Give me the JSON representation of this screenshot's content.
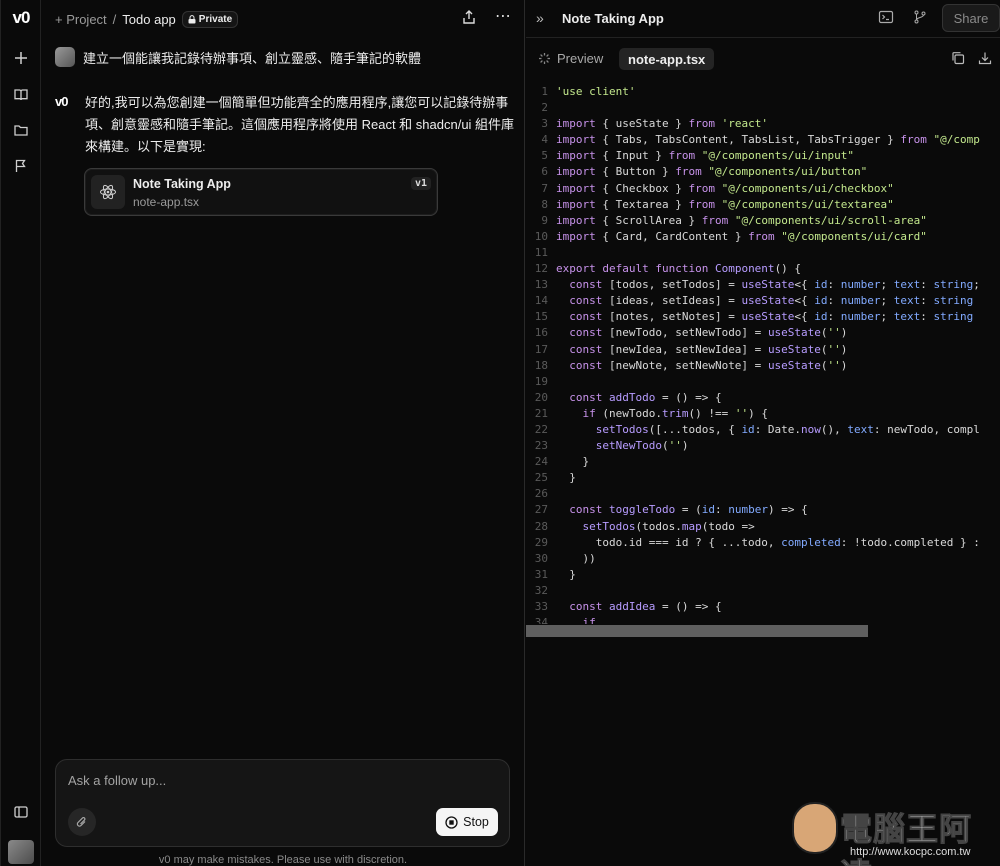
{
  "rail": {
    "logo": "v0",
    "items": [
      "new-chat",
      "library",
      "projects",
      "feedback"
    ]
  },
  "header": {
    "new_label": "+ Project",
    "separator": "/",
    "project_name": "Todo app",
    "privacy": "Private"
  },
  "user_message": {
    "text": "建立一個能讓我記錄待辦事項、創立靈感、隨手筆記的軟體"
  },
  "assistant_message": {
    "logo": "v0",
    "text": "好的,我可以為您創建一個簡單但功能齊全的應用程序,讓您可以記錄待辦事項、創意靈感和隨手筆記。這個應用程序將使用 React 和 shadcn/ui 組件庫來構建。以下是實現:"
  },
  "artifact": {
    "title": "Note Taking App",
    "file": "note-app.tsx",
    "version": "v1"
  },
  "composer": {
    "placeholder": "Ask a follow up...",
    "stop_label": "Stop",
    "disclaimer": "v0 may make mistakes. Please use with discretion."
  },
  "code_panel": {
    "title": "Note Taking App",
    "share_label": "Share",
    "preview_tab": "Preview",
    "file_tab": "note-app.tsx"
  },
  "code_lines": [
    [
      [
        "str",
        "'use client'"
      ]
    ],
    [],
    [
      [
        "kw",
        "import"
      ],
      [
        "pl",
        " { useState } "
      ],
      [
        "kw",
        "from"
      ],
      [
        "str",
        " 'react'"
      ]
    ],
    [
      [
        "kw",
        "import"
      ],
      [
        "pl",
        " { Tabs, TabsContent, TabsList, TabsTrigger } "
      ],
      [
        "kw",
        "from"
      ],
      [
        "str",
        " \"@/comp"
      ]
    ],
    [
      [
        "kw",
        "import"
      ],
      [
        "pl",
        " { Input } "
      ],
      [
        "kw",
        "from"
      ],
      [
        "str",
        " \"@/components/ui/input\""
      ]
    ],
    [
      [
        "kw",
        "import"
      ],
      [
        "pl",
        " { Button } "
      ],
      [
        "kw",
        "from"
      ],
      [
        "str",
        " \"@/components/ui/button\""
      ]
    ],
    [
      [
        "kw",
        "import"
      ],
      [
        "pl",
        " { Checkbox } "
      ],
      [
        "kw",
        "from"
      ],
      [
        "str",
        " \"@/components/ui/checkbox\""
      ]
    ],
    [
      [
        "kw",
        "import"
      ],
      [
        "pl",
        " { Textarea } "
      ],
      [
        "kw",
        "from"
      ],
      [
        "str",
        " \"@/components/ui/textarea\""
      ]
    ],
    [
      [
        "kw",
        "import"
      ],
      [
        "pl",
        " { ScrollArea } "
      ],
      [
        "kw",
        "from"
      ],
      [
        "str",
        " \"@/components/ui/scroll-area\""
      ]
    ],
    [
      [
        "kw",
        "import"
      ],
      [
        "pl",
        " { Card, CardContent } "
      ],
      [
        "kw",
        "from"
      ],
      [
        "str",
        " \"@/components/ui/card\""
      ]
    ],
    [],
    [
      [
        "kw",
        "export default function"
      ],
      [
        "fn",
        " Component"
      ],
      [
        "pl",
        "() {"
      ]
    ],
    [
      [
        "kw",
        "  const"
      ],
      [
        "pl",
        " [todos, setTodos] = "
      ],
      [
        "fn",
        "useState"
      ],
      [
        "pl",
        "<{ "
      ],
      [
        "ty",
        "id"
      ],
      [
        "pl",
        ": "
      ],
      [
        "ty",
        "number"
      ],
      [
        "pl",
        "; "
      ],
      [
        "ty",
        "text"
      ],
      [
        "pl",
        ": "
      ],
      [
        "ty",
        "string"
      ],
      [
        "pl",
        ";"
      ]
    ],
    [
      [
        "kw",
        "  const"
      ],
      [
        "pl",
        " [ideas, setIdeas] = "
      ],
      [
        "fn",
        "useState"
      ],
      [
        "pl",
        "<{ "
      ],
      [
        "ty",
        "id"
      ],
      [
        "pl",
        ": "
      ],
      [
        "ty",
        "number"
      ],
      [
        "pl",
        "; "
      ],
      [
        "ty",
        "text"
      ],
      [
        "pl",
        ": "
      ],
      [
        "ty",
        "string"
      ]
    ],
    [
      [
        "kw",
        "  const"
      ],
      [
        "pl",
        " [notes, setNotes] = "
      ],
      [
        "fn",
        "useState"
      ],
      [
        "pl",
        "<{ "
      ],
      [
        "ty",
        "id"
      ],
      [
        "pl",
        ": "
      ],
      [
        "ty",
        "number"
      ],
      [
        "pl",
        "; "
      ],
      [
        "ty",
        "text"
      ],
      [
        "pl",
        ": "
      ],
      [
        "ty",
        "string"
      ]
    ],
    [
      [
        "kw",
        "  const"
      ],
      [
        "pl",
        " [newTodo, setNewTodo] = "
      ],
      [
        "fn",
        "useState"
      ],
      [
        "pl",
        "("
      ],
      [
        "str",
        "''"
      ],
      [
        "pl",
        ")"
      ]
    ],
    [
      [
        "kw",
        "  const"
      ],
      [
        "pl",
        " [newIdea, setNewIdea] = "
      ],
      [
        "fn",
        "useState"
      ],
      [
        "pl",
        "("
      ],
      [
        "str",
        "''"
      ],
      [
        "pl",
        ")"
      ]
    ],
    [
      [
        "kw",
        "  const"
      ],
      [
        "pl",
        " [newNote, setNewNote] = "
      ],
      [
        "fn",
        "useState"
      ],
      [
        "pl",
        "("
      ],
      [
        "str",
        "''"
      ],
      [
        "pl",
        ")"
      ]
    ],
    [],
    [
      [
        "kw",
        "  const"
      ],
      [
        "fn",
        " addTodo"
      ],
      [
        "pl",
        " = () => {"
      ]
    ],
    [
      [
        "kw",
        "    if"
      ],
      [
        "pl",
        " (newTodo."
      ],
      [
        "fn",
        "trim"
      ],
      [
        "pl",
        "() !== "
      ],
      [
        "str",
        "''"
      ],
      [
        "pl",
        ") {"
      ]
    ],
    [
      [
        "fn",
        "      setTodos"
      ],
      [
        "pl",
        "([...todos, { "
      ],
      [
        "ty",
        "id"
      ],
      [
        "pl",
        ": Date."
      ],
      [
        "fn",
        "now"
      ],
      [
        "pl",
        "(), "
      ],
      [
        "ty",
        "text"
      ],
      [
        "pl",
        ": newTodo, compl"
      ]
    ],
    [
      [
        "fn",
        "      setNewTodo"
      ],
      [
        "pl",
        "("
      ],
      [
        "str",
        "''"
      ],
      [
        "pl",
        ")"
      ]
    ],
    [
      [
        "pl",
        "    }"
      ]
    ],
    [
      [
        "pl",
        "  }"
      ]
    ],
    [],
    [
      [
        "kw",
        "  const"
      ],
      [
        "fn",
        " toggleTodo"
      ],
      [
        "pl",
        " = ("
      ],
      [
        "ty",
        "id"
      ],
      [
        "pl",
        ": "
      ],
      [
        "ty",
        "number"
      ],
      [
        "pl",
        ") => {"
      ]
    ],
    [
      [
        "fn",
        "    setTodos"
      ],
      [
        "pl",
        "(todos."
      ],
      [
        "fn",
        "map"
      ],
      [
        "pl",
        "(todo =>"
      ]
    ],
    [
      [
        "pl",
        "      todo.id === id ? { ...todo, "
      ],
      [
        "ty",
        "completed"
      ],
      [
        "pl",
        ": !todo.completed } :"
      ]
    ],
    [
      [
        "pl",
        "    ))"
      ]
    ],
    [
      [
        "pl",
        "  }"
      ]
    ],
    [],
    [
      [
        "kw",
        "  const"
      ],
      [
        "fn",
        " addIdea"
      ],
      [
        "pl",
        " = () => {"
      ]
    ],
    [
      [
        "kw",
        "    if"
      ]
    ]
  ],
  "watermark": {
    "text": "電腦王阿達",
    "url": "http://www.kocpc.com.tw"
  },
  "colors": {
    "background": "#0a0a0a",
    "keyword": "#c792ea",
    "string": "#c3e88d",
    "function": "#b79cff",
    "type": "#82aaff"
  }
}
